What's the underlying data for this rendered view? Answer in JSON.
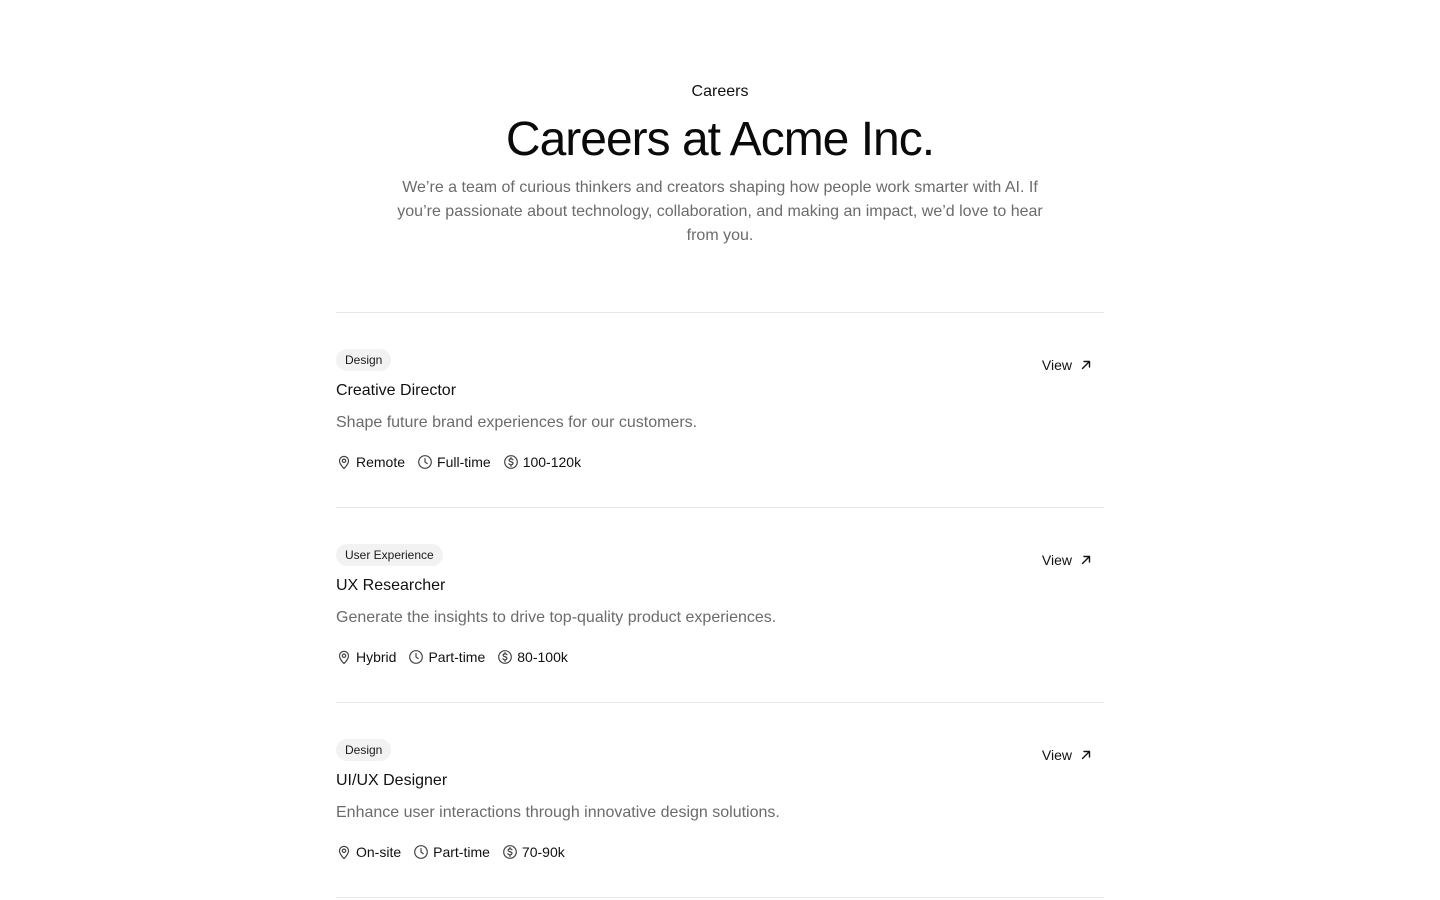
{
  "header": {
    "eyebrow": "Careers",
    "title": "Careers at Acme Inc.",
    "description": "We’re a team of curious thinkers and creators shaping how people work smarter with AI. If you’re passionate about technology, collaboration, and making an impact, we’d love to hear from you."
  },
  "jobs": [
    {
      "category": "Design",
      "title": "Creative Director",
      "description": "Shape future brand experiences for our customers.",
      "location": "Remote",
      "type": "Full-time",
      "salary": "100-120k",
      "view_label": "View"
    },
    {
      "category": "User Experience",
      "title": "UX Researcher",
      "description": "Generate the insights to drive top-quality product experiences.",
      "location": "Hybrid",
      "type": "Part-time",
      "salary": "80-100k",
      "view_label": "View"
    },
    {
      "category": "Design",
      "title": "UI/UX Designer",
      "description": "Enhance user interactions through innovative design solutions.",
      "location": "On-site",
      "type": "Part-time",
      "salary": "70-90k",
      "view_label": "View"
    }
  ],
  "icons": {
    "location": "map-pin-icon",
    "type": "clock-icon",
    "salary": "dollar-circle-icon",
    "view": "arrow-up-right-icon"
  },
  "colors": {
    "text": "#111111",
    "muted": "#6b6b6b",
    "badge_bg": "#f2f2f2",
    "divider": "#e6e6e6"
  }
}
